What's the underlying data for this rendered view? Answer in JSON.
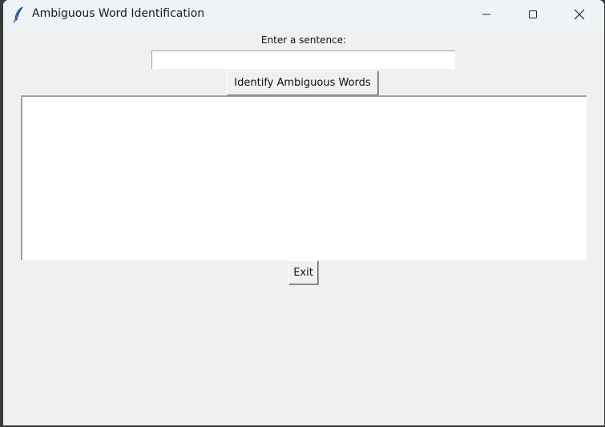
{
  "window": {
    "title": "Ambiguous Word Identification",
    "icon": "feather-icon"
  },
  "form": {
    "prompt_label": "Enter a sentence:",
    "sentence_value": "",
    "identify_label": "Identify Ambiguous Words",
    "output_text": "",
    "exit_label": "Exit"
  }
}
